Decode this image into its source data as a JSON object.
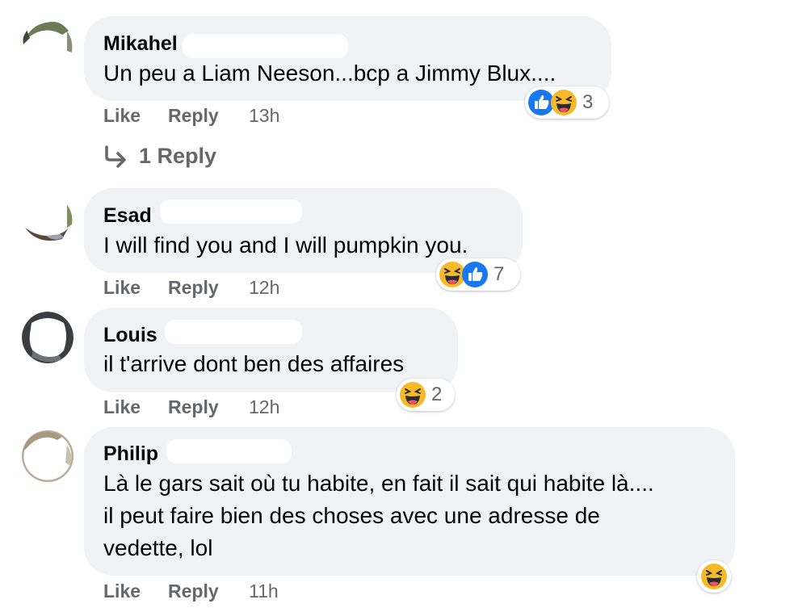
{
  "comments": [
    {
      "author": "Mikahel",
      "text_lines": [
        "Un peu a Liam Neeson...bcp a Jimmy Blux...."
      ],
      "reactions": [
        "like-icon",
        "haha-icon"
      ],
      "reaction_count": "3",
      "like": "Like",
      "reply": "Reply",
      "time": "13h",
      "replies_label": "1 Reply"
    },
    {
      "author": "Esad",
      "text_lines": [
        "I will find you and I will pumpkin you."
      ],
      "reactions": [
        "haha-icon",
        "like-icon"
      ],
      "reaction_count": "7",
      "like": "Like",
      "reply": "Reply",
      "time": "12h"
    },
    {
      "author": "Louis",
      "text_lines": [
        "il t'arrive dont ben des affaires"
      ],
      "reactions": [
        "haha-icon"
      ],
      "reaction_count": "2",
      "like": "Like",
      "reply": "Reply",
      "time": "12h"
    },
    {
      "author": "Philip",
      "text_lines": [
        "Là le gars sait où tu habite, en fait il sait qui habite là....",
        "il peut faire bien des choses avec une adresse de",
        "vedette, lol"
      ],
      "reactions": [
        "haha-icon"
      ],
      "reaction_count": "",
      "like": "Like",
      "reply": "Reply",
      "time": "11h"
    }
  ],
  "colors": {
    "bubble": "#f0f2f5",
    "text": "#050505",
    "secondary": "#65676b",
    "like_blue": "#1877f2",
    "haha_yellow": "#f7b928"
  }
}
